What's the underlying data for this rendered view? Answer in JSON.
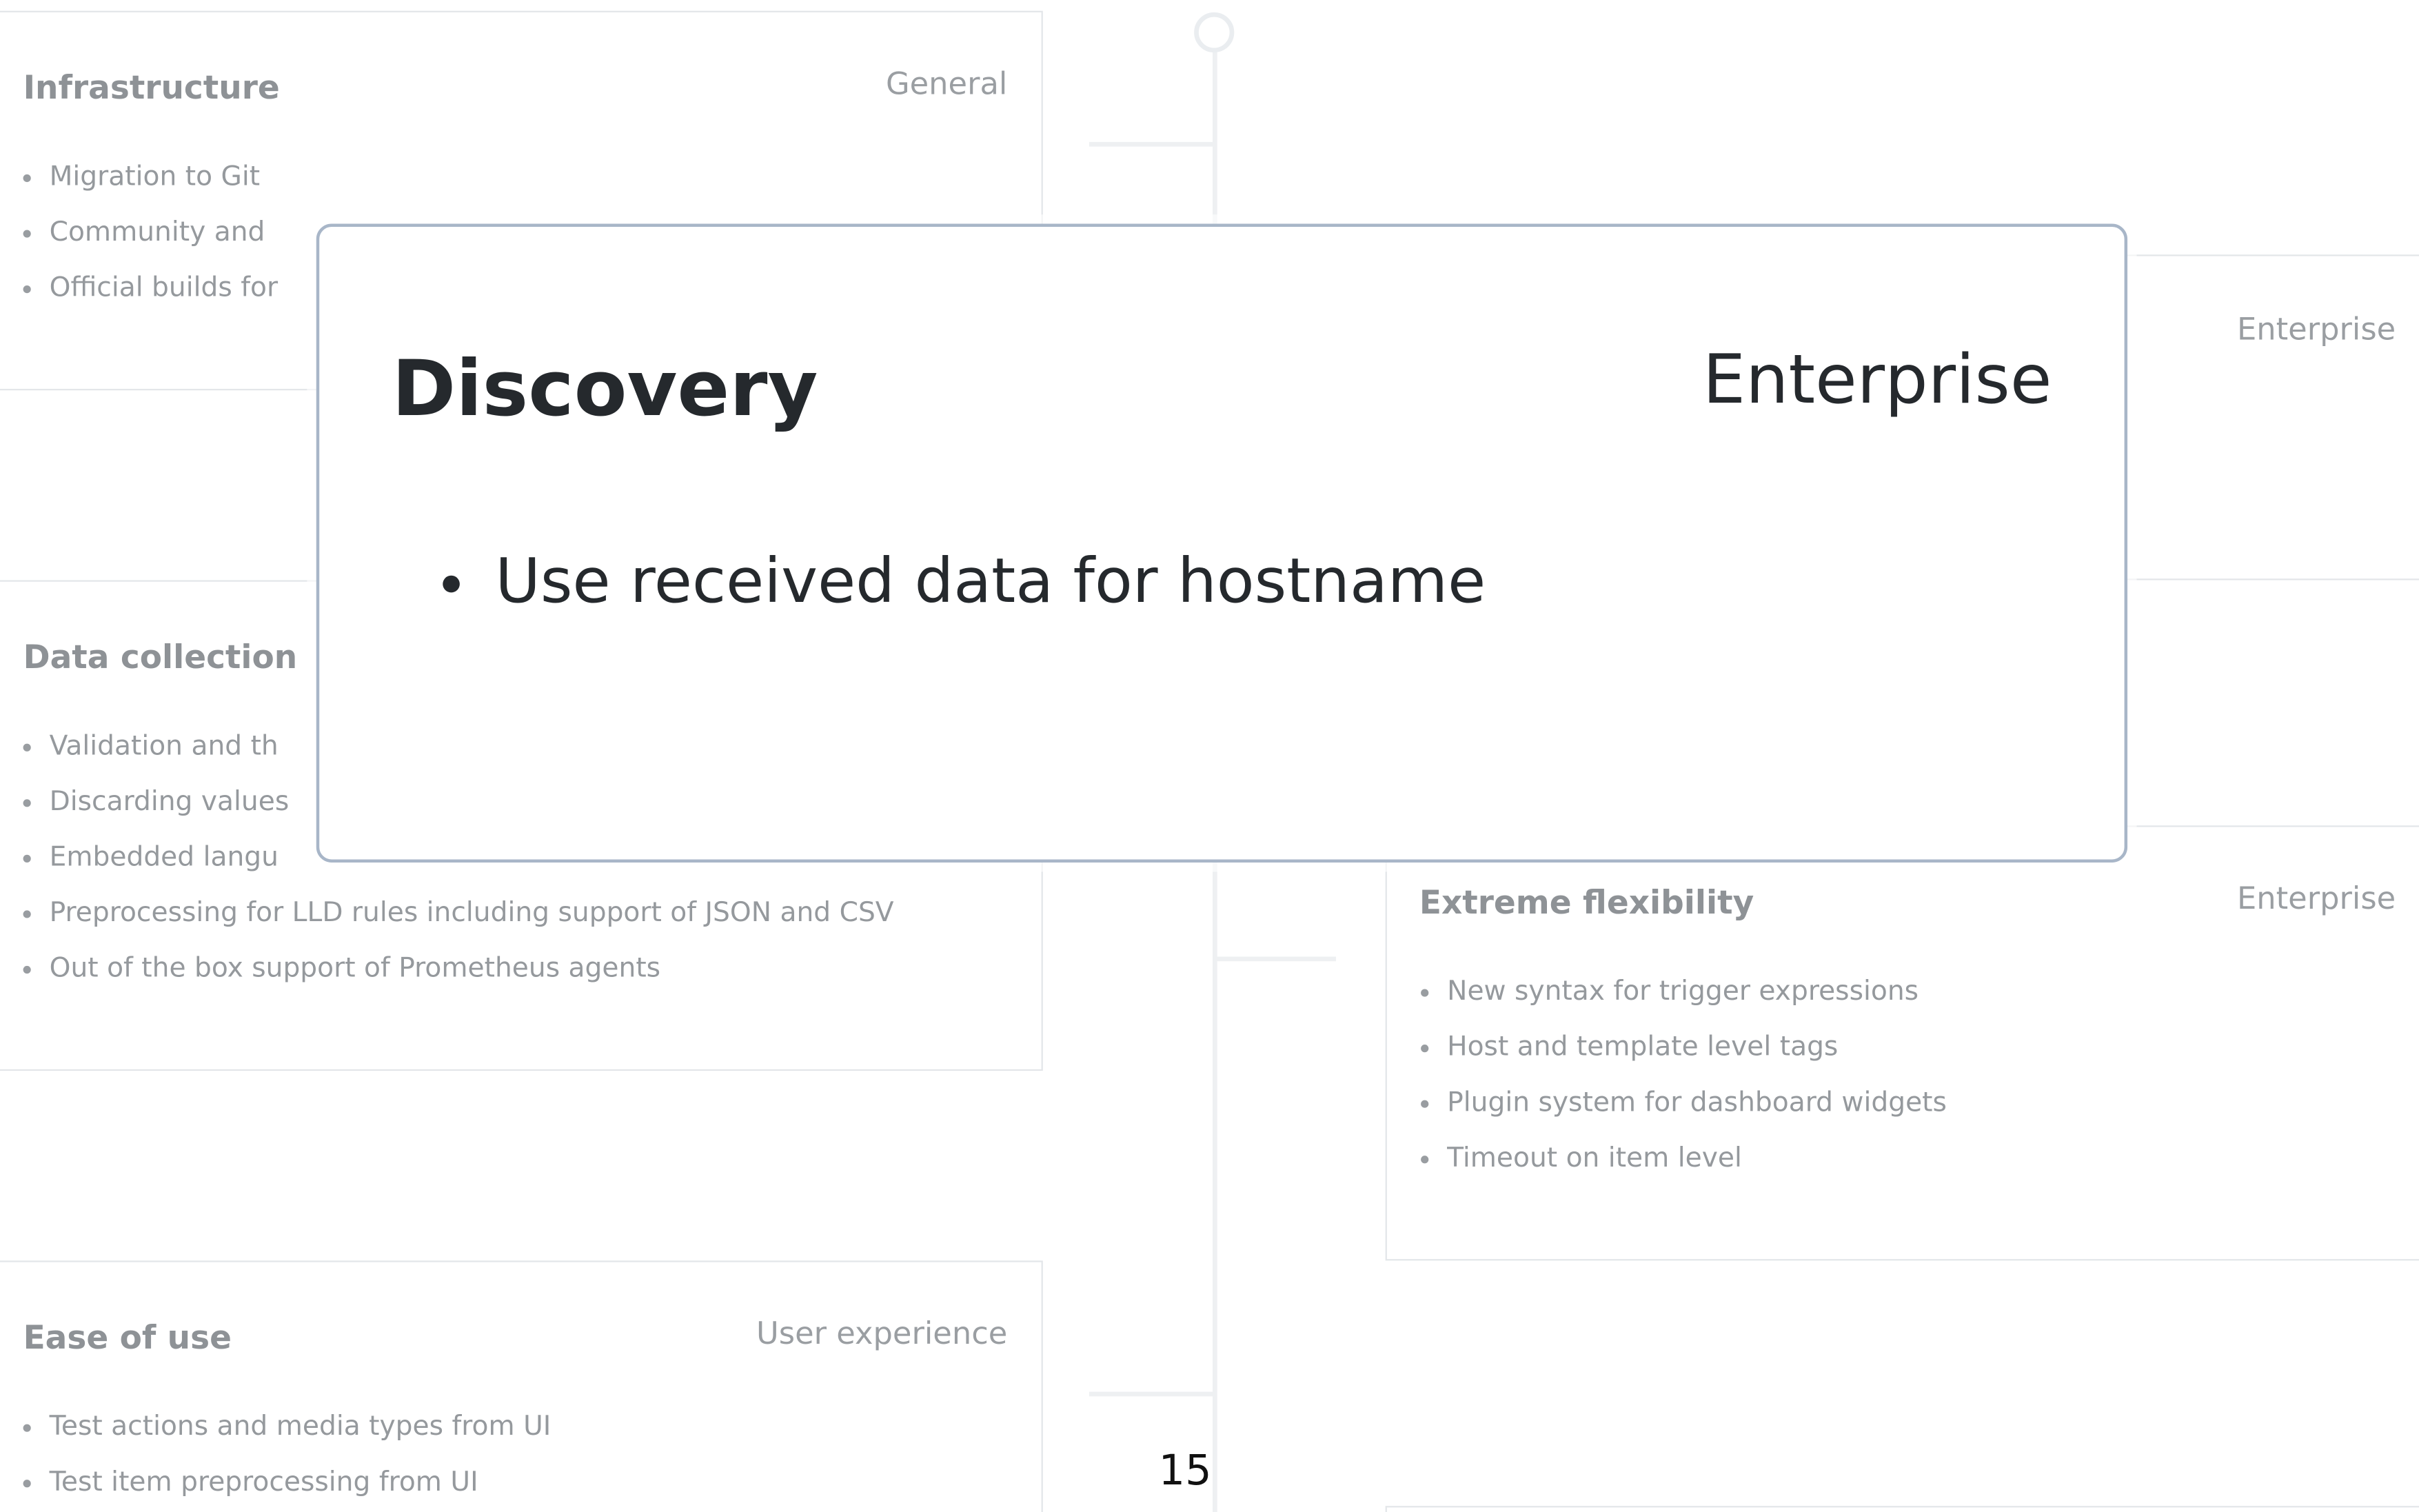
{
  "cards": {
    "infrastructure": {
      "title": "Infrastructure",
      "tag": "General",
      "items": [
        "Migration to Git",
        "Community and",
        "Official builds for"
      ]
    },
    "top_right": {
      "tag": "Enterprise"
    },
    "data_collection": {
      "title": "Data collection",
      "items": [
        "Validation and th",
        "Discarding values",
        "Embedded langu",
        "Preprocessing for LLD rules including support of JSON and CSV",
        "Out of the box support of Prometheus agents"
      ]
    },
    "extreme_flexibility": {
      "title": "Extreme flexibility",
      "tag": "Enterprise",
      "items": [
        "New syntax for trigger expressions",
        "Host and template level tags",
        "Plugin system for dashboard widgets",
        "Timeout on item level"
      ]
    },
    "ease_of_use": {
      "title": "Ease of use",
      "tag": "User experience",
      "items": [
        "Test actions and media types from UI",
        "Test item preprocessing from UI"
      ]
    }
  },
  "modal": {
    "title": "Discovery",
    "tag": "Enterprise",
    "items": [
      "Use received data for hostname"
    ]
  },
  "page_number": "15"
}
